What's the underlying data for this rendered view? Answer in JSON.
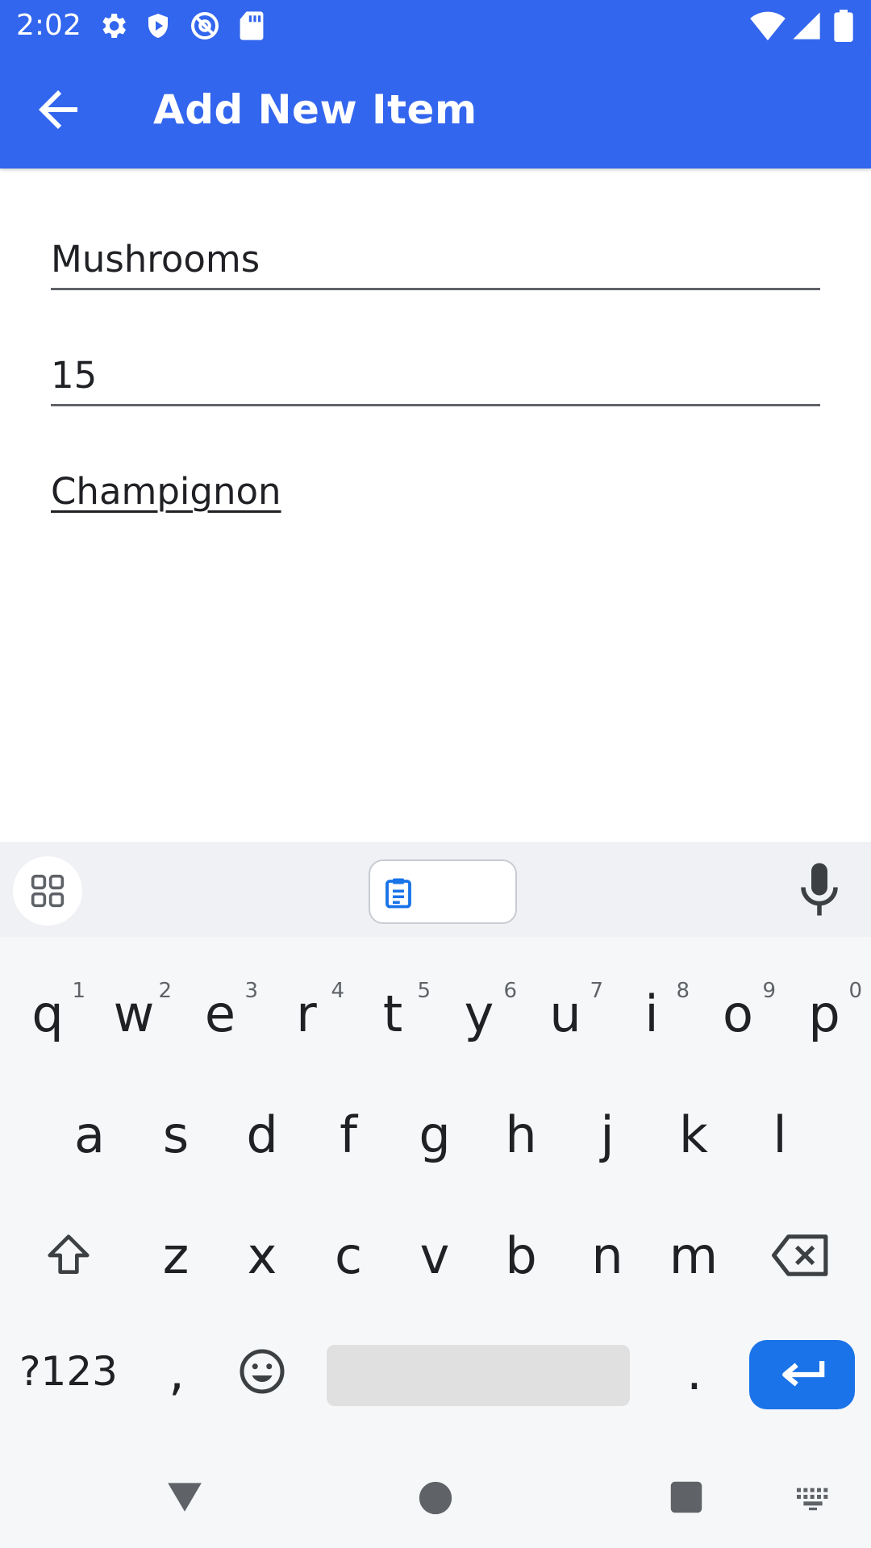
{
  "status_bar": {
    "time": "2:02",
    "left_icons": [
      "gear-icon",
      "shield-icon",
      "at-sign-icon",
      "sd-card-icon"
    ],
    "right_icons": [
      "wifi-icon",
      "cell-signal-icon",
      "battery-icon"
    ]
  },
  "app_bar": {
    "title": "Add New Item",
    "back_icon": "arrow-back-icon"
  },
  "form": {
    "name_value": "Mushrooms",
    "quantity_value": "15",
    "note_value": "Champignon"
  },
  "keyboard": {
    "toolbar": {
      "apps_icon": "grid-icon",
      "clipboard_icon": "clipboard-icon",
      "mic_icon": "mic-icon"
    },
    "row1": [
      {
        "key": "q",
        "hint": "1"
      },
      {
        "key": "w",
        "hint": "2"
      },
      {
        "key": "e",
        "hint": "3"
      },
      {
        "key": "r",
        "hint": "4"
      },
      {
        "key": "t",
        "hint": "5"
      },
      {
        "key": "y",
        "hint": "6"
      },
      {
        "key": "u",
        "hint": "7"
      },
      {
        "key": "i",
        "hint": "8"
      },
      {
        "key": "o",
        "hint": "9"
      },
      {
        "key": "p",
        "hint": "0"
      }
    ],
    "row2": [
      "a",
      "s",
      "d",
      "f",
      "g",
      "h",
      "j",
      "k",
      "l"
    ],
    "row3": [
      "z",
      "x",
      "c",
      "v",
      "b",
      "n",
      "m"
    ],
    "row4": {
      "symbols": "?123",
      "comma": ",",
      "period": "."
    },
    "shift_icon": "shift-icon",
    "backspace_icon": "backspace-icon",
    "emoji_icon": "emoji-icon",
    "enter_icon": "enter-icon",
    "accent_color": "#1a73e8"
  },
  "nav_bar": {
    "icons": [
      "nav-back-icon",
      "nav-home-icon",
      "nav-recents-icon",
      "keyboard-switch-icon"
    ]
  },
  "colors": {
    "app_bar": "#3366ee",
    "keyboard_bg": "#f6f7f9"
  }
}
